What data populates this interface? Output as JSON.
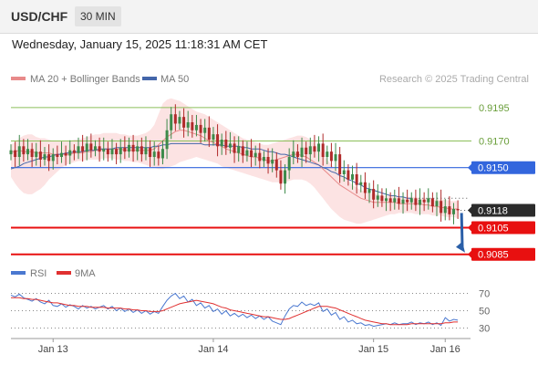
{
  "header": {
    "pair": "USD/CHF",
    "timeframe": "30 MIN"
  },
  "datetime": "Wednesday, January 15, 2025 11:18:31 AM CET",
  "legend": {
    "ma20_bb": "MA 20 + Bollinger Bands",
    "ma50": "MA 50",
    "credit": "Research © 2025 Trading Central",
    "rsi": "RSI",
    "ma9": "9MA"
  },
  "colors": {
    "candle_up": "#3d8a4a",
    "candle_down": "#b02a2a",
    "bb_fill": "#fbdcdc",
    "ma20": "#e88a8a",
    "ma50": "#4466aa",
    "green_level": "#8cbf5a",
    "blue_level": "#3366dd",
    "red_level": "#e81010",
    "current_tag": "#2b2b2b",
    "rsi_line": "#4a78d0",
    "ma9_line": "#e03030",
    "arrow": "#2a5fa8"
  },
  "levels": [
    {
      "value": 0.9195,
      "label": "0.9195",
      "kind": "green"
    },
    {
      "value": 0.917,
      "label": "0.9170",
      "kind": "green"
    },
    {
      "value": 0.915,
      "label": "0.9150",
      "kind": "blue"
    },
    {
      "value": 0.9118,
      "label": "0.9118",
      "kind": "current"
    },
    {
      "value": 0.9105,
      "label": "0.9105",
      "kind": "red"
    },
    {
      "value": 0.9085,
      "label": "0.9085",
      "kind": "red"
    }
  ],
  "x_axis": {
    "ticks": [
      "Jan 13",
      "Jan 14",
      "Jan 15",
      "Jan 16"
    ]
  },
  "rsi_axis": {
    "ticks": [
      "70",
      "50",
      "30"
    ]
  },
  "chart_data": [
    {
      "type": "candlestick",
      "title": "USD/CHF",
      "timeframe": "30 MIN",
      "ylim": [
        0.908,
        0.921
      ],
      "xlim": [
        0,
        109
      ],
      "x_ticks": [
        {
          "x": 10,
          "label": "Jan 13"
        },
        {
          "x": 48,
          "label": "Jan 14"
        },
        {
          "x": 86,
          "label": "Jan 15"
        },
        {
          "x": 103,
          "label": "Jan 16"
        }
      ],
      "close": [
        0.9163,
        0.9158,
        0.9166,
        0.916,
        0.9164,
        0.9158,
        0.9162,
        0.9156,
        0.916,
        0.9155,
        0.916,
        0.9158,
        0.9161,
        0.9159,
        0.9163,
        0.9161,
        0.9166,
        0.9162,
        0.9168,
        0.9163,
        0.9166,
        0.9162,
        0.9164,
        0.916,
        0.9164,
        0.916,
        0.9165,
        0.9162,
        0.9167,
        0.9162,
        0.9166,
        0.916,
        0.9165,
        0.9158,
        0.9162,
        0.9157,
        0.9164,
        0.9178,
        0.919,
        0.9183,
        0.9188,
        0.918,
        0.9184,
        0.9178,
        0.9182,
        0.9176,
        0.918,
        0.9171,
        0.9175,
        0.9166,
        0.9171,
        0.9165,
        0.9168,
        0.9161,
        0.9166,
        0.9159,
        0.9163,
        0.9158,
        0.9161,
        0.9155,
        0.9158,
        0.9153,
        0.9156,
        0.9148,
        0.9138,
        0.9148,
        0.9158,
        0.9162,
        0.9158,
        0.9165,
        0.916,
        0.9166,
        0.9162,
        0.9168,
        0.9158,
        0.9162,
        0.9155,
        0.916,
        0.9145,
        0.9148,
        0.9141,
        0.9145,
        0.9137,
        0.9139,
        0.9131,
        0.9134,
        0.9126,
        0.9129,
        0.9125,
        0.9127,
        0.9124,
        0.9127,
        0.9123,
        0.9126,
        0.9124,
        0.9127,
        0.9122,
        0.9126,
        0.9124,
        0.9127,
        0.9121,
        0.9125,
        0.9116,
        0.9121,
        0.9115,
        0.9119,
        0.9118
      ],
      "ma20": [
        0.9162,
        0.9162,
        0.9163,
        0.9162,
        0.9162,
        0.9162,
        0.9161,
        0.9161,
        0.9161,
        0.9161,
        0.916,
        0.916,
        0.916,
        0.916,
        0.916,
        0.9161,
        0.9161,
        0.9161,
        0.9162,
        0.9162,
        0.9163,
        0.9163,
        0.9164,
        0.9164,
        0.9164,
        0.9164,
        0.9164,
        0.9163,
        0.9163,
        0.9163,
        0.9163,
        0.9163,
        0.9163,
        0.9163,
        0.9164,
        0.9167,
        0.917,
        0.9173,
        0.9175,
        0.9177,
        0.9178,
        0.9178,
        0.9177,
        0.9176,
        0.9175,
        0.9174,
        0.9172,
        0.917,
        0.9169,
        0.9167,
        0.9166,
        0.9164,
        0.9163,
        0.9162,
        0.9161,
        0.916,
        0.9159,
        0.9158,
        0.9158,
        0.9157,
        0.9156,
        0.9155,
        0.9155,
        0.9156,
        0.9157,
        0.9158,
        0.9159,
        0.916,
        0.916,
        0.9159,
        0.9158,
        0.9156,
        0.9154,
        0.9152,
        0.9149,
        0.9146,
        0.9143,
        0.914,
        0.9137,
        0.9135,
        0.9133,
        0.9131,
        0.9129,
        0.9127,
        0.9126,
        0.9125,
        0.9124,
        0.9124,
        0.9124,
        0.9124,
        0.9124,
        0.9124,
        0.9123,
        0.9123,
        0.9123,
        0.9123,
        0.9123,
        0.9123,
        0.9122,
        0.9122,
        0.9121,
        0.9121,
        0.912,
        0.912,
        0.9119,
        0.9119,
        0.9119
      ],
      "ma50": [
        0.9149,
        0.915,
        0.9151,
        0.9153,
        0.9154,
        0.9155,
        0.9156,
        0.9157,
        0.9158,
        0.9158,
        0.9159,
        0.916,
        0.916,
        0.9161,
        0.9161,
        0.9162,
        0.9162,
        0.9162,
        0.9163,
        0.9163,
        0.9163,
        0.9164,
        0.9164,
        0.9164,
        0.9164,
        0.9165,
        0.9165,
        0.9165,
        0.9165,
        0.9165,
        0.9165,
        0.9165,
        0.9165,
        0.9165,
        0.9166,
        0.9166,
        0.9167,
        0.9167,
        0.9168,
        0.9168,
        0.9168,
        0.9168,
        0.9168,
        0.9168,
        0.9168,
        0.9168,
        0.9167,
        0.9167,
        0.9167,
        0.9167,
        0.9167,
        0.9166,
        0.9166,
        0.9166,
        0.9166,
        0.9165,
        0.9165,
        0.9164,
        0.9164,
        0.9164,
        0.9163,
        0.9162,
        0.9162,
        0.9161,
        0.916,
        0.916,
        0.9159,
        0.9158,
        0.9157,
        0.9156,
        0.9155,
        0.9154,
        0.9153,
        0.9152,
        0.915,
        0.9149,
        0.9147,
        0.9146,
        0.9144,
        0.9143,
        0.9141,
        0.914,
        0.9138,
        0.9137,
        0.9135,
        0.9134,
        0.9133,
        0.9132,
        0.9131,
        0.913,
        0.9129,
        0.9129,
        0.9128,
        0.9128,
        0.9127,
        0.9127
      ],
      "bb_upper": [
        0.9167,
        0.9169,
        0.9172,
        0.9174,
        0.9175,
        0.9175,
        0.9173,
        0.9172,
        0.9172,
        0.9171,
        0.917,
        0.917,
        0.917,
        0.917,
        0.917,
        0.9171,
        0.9171,
        0.9172,
        0.9173,
        0.9174,
        0.9175,
        0.9175,
        0.9176,
        0.9176,
        0.9176,
        0.9176,
        0.9175,
        0.9175,
        0.9174,
        0.9174,
        0.9174,
        0.9175,
        0.9176,
        0.9178,
        0.9182,
        0.919,
        0.9198,
        0.9201,
        0.9202,
        0.9201,
        0.92,
        0.9198,
        0.9196,
        0.9194,
        0.9192,
        0.9191,
        0.919,
        0.9188,
        0.9186,
        0.9184,
        0.9182,
        0.918,
        0.9178,
        0.9176,
        0.9174,
        0.9172,
        0.9171,
        0.917,
        0.9169,
        0.9168,
        0.9167,
        0.9167,
        0.9168,
        0.9169,
        0.917,
        0.9171,
        0.9172,
        0.9173,
        0.9174,
        0.9174,
        0.9173,
        0.9171,
        0.9168,
        0.9164,
        0.916,
        0.9156,
        0.9152,
        0.9149,
        0.9146,
        0.9143,
        0.914,
        0.9137,
        0.9135,
        0.9133,
        0.9132,
        0.9131,
        0.913,
        0.913,
        0.9129,
        0.9129,
        0.9129,
        0.9129,
        0.9128,
        0.9128,
        0.9128,
        0.9128,
        0.9128,
        0.9127,
        0.9127,
        0.9127,
        0.9126,
        0.9126,
        0.9126,
        0.9126,
        0.9125,
        0.9125,
        0.9125
      ],
      "bb_lower": [
        0.9143,
        0.9138,
        0.9134,
        0.9131,
        0.913,
        0.913,
        0.9132,
        0.9134,
        0.9137,
        0.9141,
        0.9144,
        0.9147,
        0.915,
        0.9152,
        0.9153,
        0.9154,
        0.9155,
        0.9155,
        0.9156,
        0.9156,
        0.9156,
        0.9156,
        0.9157,
        0.9157,
        0.9157,
        0.9156,
        0.9156,
        0.9155,
        0.9155,
        0.9154,
        0.9154,
        0.9153,
        0.9152,
        0.9151,
        0.915,
        0.9149,
        0.9149,
        0.915,
        0.9151,
        0.9152,
        0.9154,
        0.9155,
        0.9156,
        0.9157,
        0.9158,
        0.9157,
        0.9156,
        0.9155,
        0.9154,
        0.9153,
        0.9151,
        0.915,
        0.9149,
        0.9148,
        0.9147,
        0.9146,
        0.9145,
        0.9144,
        0.9143,
        0.9142,
        0.9141,
        0.914,
        0.9139,
        0.9139,
        0.9139,
        0.9139,
        0.914,
        0.9141,
        0.9141,
        0.9141,
        0.914,
        0.9138,
        0.9135,
        0.9131,
        0.9127,
        0.9123,
        0.9119,
        0.9116,
        0.9113,
        0.9111,
        0.911,
        0.9109,
        0.9108,
        0.9108,
        0.9109,
        0.911,
        0.9111,
        0.9112,
        0.9113,
        0.9114,
        0.9115,
        0.9115,
        0.9116,
        0.9116,
        0.9116,
        0.9116,
        0.9115,
        0.9115,
        0.9115,
        0.9115,
        0.9114,
        0.9114,
        0.9114,
        0.9113,
        0.9113,
        0.9113,
        0.9112
      ],
      "forecast": {
        "from": 0.9118,
        "to": 0.9085
      }
    },
    {
      "type": "line",
      "title": "RSI",
      "ylim": [
        20,
        80
      ],
      "yticks": [
        30,
        50,
        70
      ],
      "series": [
        {
          "name": "RSI",
          "values": [
            68,
            66,
            69,
            65,
            63,
            61,
            64,
            60,
            58,
            62,
            56,
            55,
            58,
            54,
            57,
            55,
            52,
            56,
            53,
            55,
            52,
            54,
            56,
            52,
            55,
            50,
            53,
            49,
            52,
            48,
            51,
            47,
            50,
            46,
            49,
            47,
            55,
            62,
            67,
            70,
            64,
            67,
            60,
            63,
            56,
            59,
            53,
            56,
            49,
            52,
            46,
            50,
            44,
            47,
            43,
            46,
            42,
            45,
            41,
            44,
            40,
            43,
            38,
            36,
            34,
            44,
            52,
            56,
            55,
            60,
            56,
            58,
            56,
            59,
            49,
            52,
            45,
            48,
            40,
            43,
            37,
            39,
            35,
            36,
            33,
            34,
            32,
            33,
            34,
            35,
            34,
            36,
            34,
            35,
            35,
            37,
            34,
            36,
            35,
            37,
            34,
            36,
            33,
            42,
            38,
            40,
            39
          ]
        },
        {
          "name": "9MA",
          "values": [
            65,
            65,
            65,
            64,
            64,
            63,
            63,
            62,
            61,
            60,
            59,
            59,
            58,
            57,
            56,
            56,
            55,
            55,
            55,
            54,
            54,
            54,
            54,
            53,
            53,
            53,
            53,
            52,
            52,
            51,
            51,
            50,
            50,
            49,
            49,
            49,
            50,
            52,
            54,
            56,
            58,
            59,
            60,
            61,
            62,
            61,
            60,
            59,
            58,
            56,
            54,
            53,
            51,
            50,
            49,
            48,
            47,
            46,
            45,
            44,
            43,
            43,
            42,
            41,
            40,
            40,
            41,
            43,
            45,
            47,
            49,
            51,
            53,
            55,
            55,
            55,
            54,
            53,
            51,
            49,
            47,
            45,
            43,
            41,
            39,
            38,
            37,
            36,
            35,
            35,
            34,
            34,
            34,
            34,
            34,
            35,
            35,
            35,
            35,
            35,
            35,
            35,
            35,
            36,
            36,
            37,
            37
          ]
        }
      ]
    }
  ]
}
